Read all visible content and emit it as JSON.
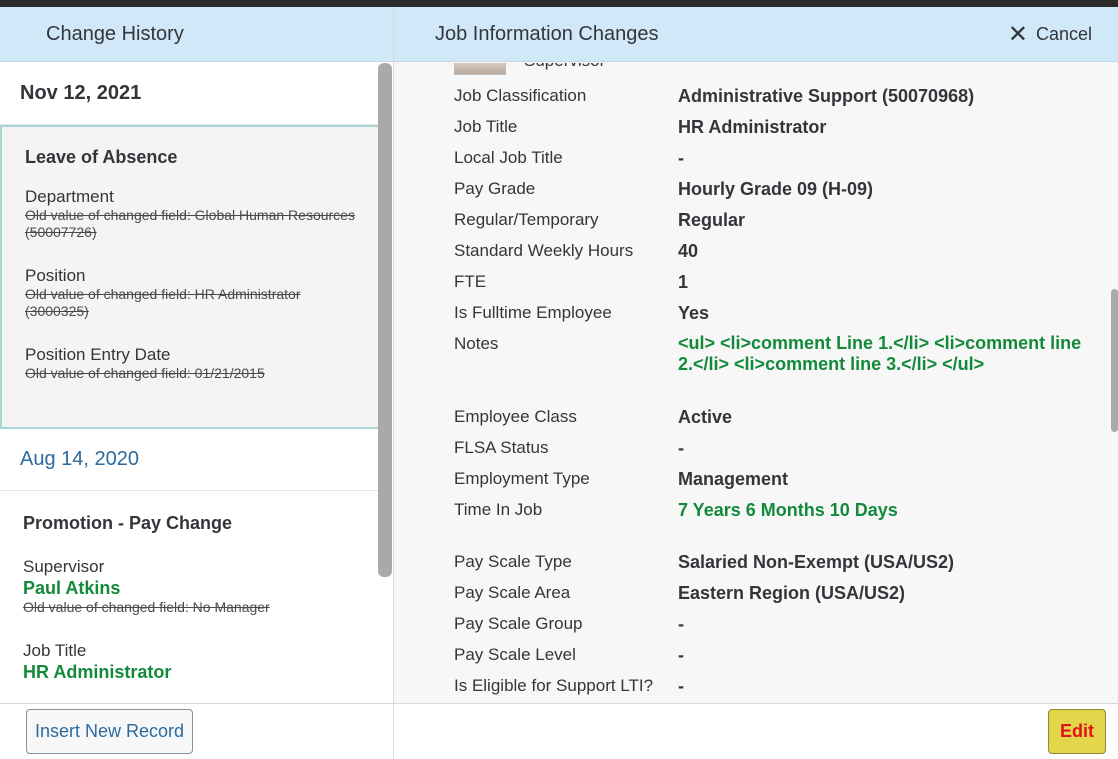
{
  "left": {
    "title": "Change History",
    "entries": [
      {
        "date": "Nov 12, 2021",
        "event": "Leave of Absence",
        "fields": [
          {
            "label": "Department",
            "old": "Old value of changed field: Global Human Resources (50007726)"
          },
          {
            "label": "Position",
            "old": "Old value of changed field: HR Administrator (3000325)"
          },
          {
            "label": "Position Entry Date",
            "old": "Old value of changed field: 01/21/2015"
          }
        ]
      },
      {
        "date": "Aug 14, 2020",
        "event": "Promotion - Pay Change",
        "fields": [
          {
            "label": "Supervisor",
            "value": "Paul Atkins",
            "old": "Old value of changed field: No Manager"
          },
          {
            "label": "Job Title",
            "value": "HR Administrator"
          }
        ]
      }
    ],
    "insert_label": "Insert New Record"
  },
  "right": {
    "title": "Job Information Changes",
    "cancel_label": "Cancel",
    "supervisor_label": "Supervisor",
    "rows": [
      {
        "label": "Job Classification",
        "value": "Administrative Support (50070968)"
      },
      {
        "label": "Job Title",
        "value": "HR Administrator"
      },
      {
        "label": "Local Job Title",
        "value": "-"
      },
      {
        "label": "Pay Grade",
        "value": "Hourly Grade 09 (H-09)"
      },
      {
        "label": "Regular/Temporary",
        "value": "Regular"
      },
      {
        "label": "Standard Weekly Hours",
        "value": "40"
      },
      {
        "label": "FTE",
        "value": "1"
      },
      {
        "label": "Is Fulltime Employee",
        "value": "Yes"
      },
      {
        "label": "Notes",
        "value": "<ul> <li>comment Line 1.</li> <li>comment line 2.</li> <li>comment line 3.</li> </ul>"
      },
      {
        "label": "Employee Class",
        "value": "Active"
      },
      {
        "label": "FLSA Status",
        "value": "-"
      },
      {
        "label": "Employment Type",
        "value": "Management"
      },
      {
        "label": "Time In Job",
        "value": "7 Years 6 Months 10 Days"
      },
      {
        "label": "Pay Scale Type",
        "value": "Salaried Non-Exempt (USA/US2)"
      },
      {
        "label": "Pay Scale Area",
        "value": "Eastern Region (USA/US2)"
      },
      {
        "label": "Pay Scale Group",
        "value": "-"
      },
      {
        "label": "Pay Scale Level",
        "value": "-"
      },
      {
        "label": "Is Eligible for Support LTI?",
        "value": "-"
      }
    ],
    "edit_label": "Edit"
  },
  "colors": {
    "header_bg": "#d1e8f9",
    "changed_value": "#138a3a",
    "link": "#2b6a9e",
    "edit_bg": "#e3d64a",
    "edit_text": "#e0141e"
  }
}
